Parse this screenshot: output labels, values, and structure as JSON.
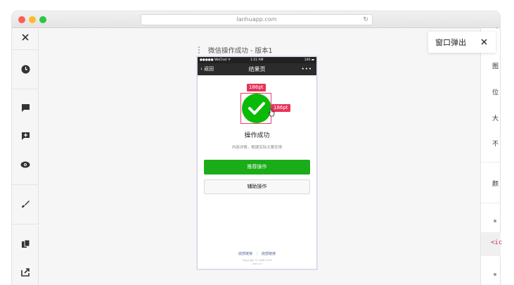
{
  "browser": {
    "url": "lanhuapp.com"
  },
  "artboard": {
    "title": "微信操作成功 - 版本1"
  },
  "phone": {
    "status_left": "●●●●● WeChat ᯤ",
    "status_time": "1:21 AM",
    "status_right": "100 ▬",
    "nav_back": "‹ 返回",
    "nav_title": "结果页",
    "nav_more": "•••",
    "msg_title": "操作成功",
    "msg_desc": "内容详情，根据实际文案安排",
    "primary_button": "推荐操作",
    "default_button": "辅助操作",
    "footer_link_1": "底部链接",
    "footer_sep": "|",
    "footer_link_2": "底部链接",
    "copyright_1": "Copyright © 2008-2016",
    "copyright_2": "weui.io"
  },
  "measure": {
    "width_tag": "186pt",
    "height_tag": "186pt"
  },
  "popup": {
    "label": "窗口弹出"
  },
  "right_panel": {
    "items": [
      "图",
      "位",
      "大",
      "不",
      "颜"
    ],
    "code_snippet": "<ic",
    "top_glyph": "⌃"
  },
  "left_toolbar": {
    "icons": [
      "close-icon",
      "history-icon",
      "comment-icon",
      "add-comment-icon",
      "eye-icon",
      "brush-icon",
      "slices-icon",
      "export-icon"
    ]
  },
  "colors": {
    "wechat_green": "#1aad19",
    "success_green": "#09bb07",
    "annotation_red": "#e6335a",
    "nav_dark": "#2b2b2b"
  }
}
